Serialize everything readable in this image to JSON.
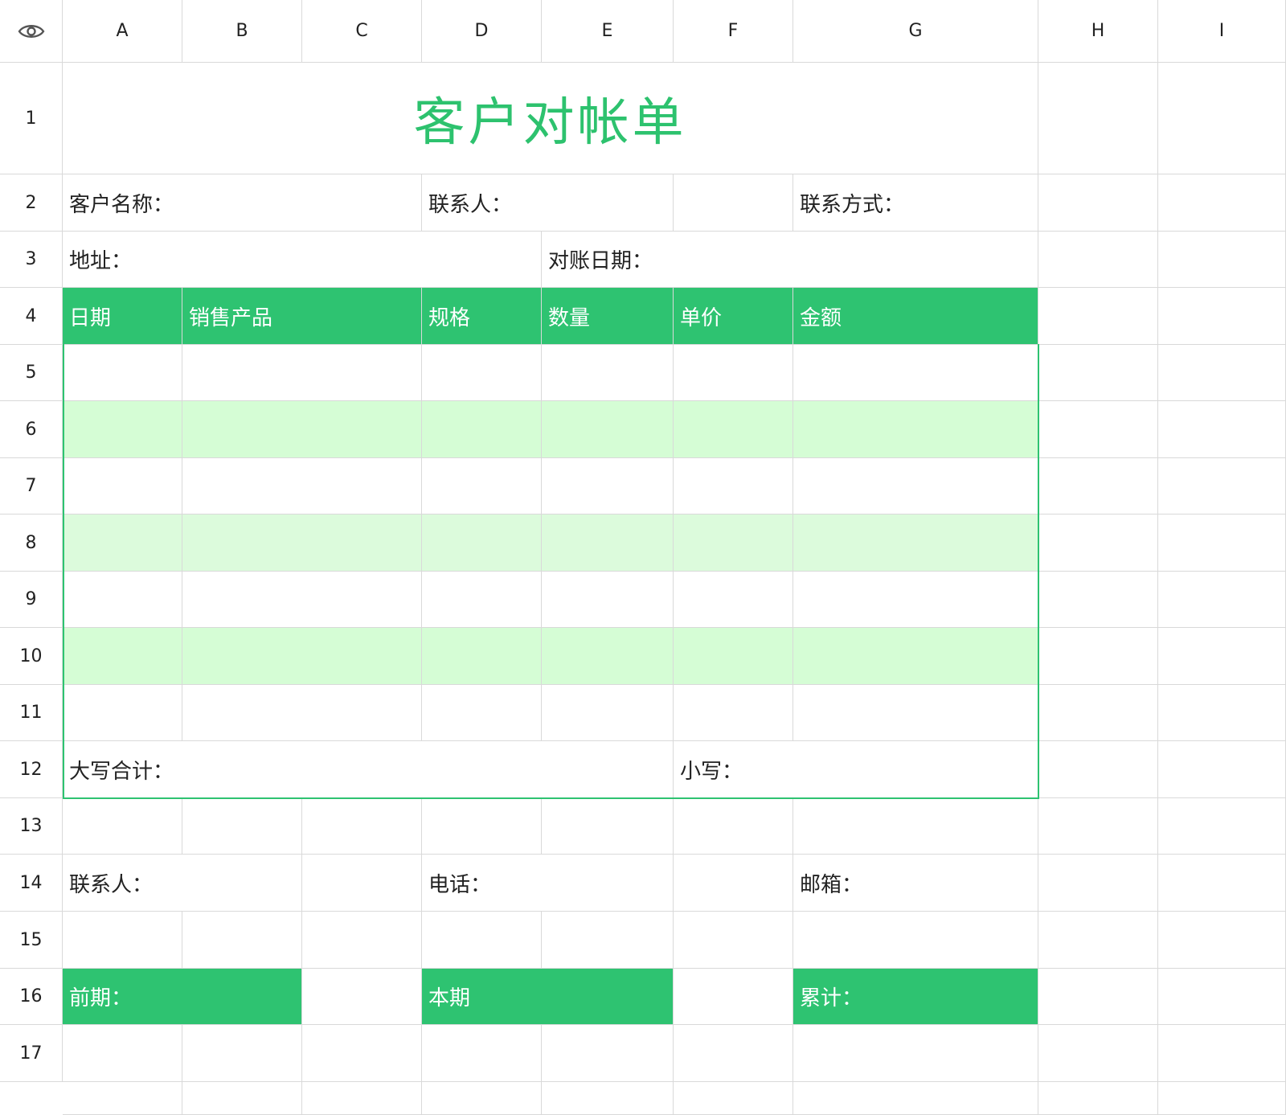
{
  "sheet": {
    "columns": [
      "A",
      "B",
      "C",
      "D",
      "E",
      "F",
      "G",
      "H",
      "I"
    ],
    "rows": [
      "1",
      "2",
      "3",
      "4",
      "5",
      "6",
      "7",
      "8",
      "9",
      "10",
      "11",
      "12",
      "13",
      "14",
      "15",
      "16",
      "17"
    ]
  },
  "doc": {
    "title": "客户对帐单",
    "customer_name_label": "客户名称：",
    "contact_label": "联系人：",
    "contact_method_label": "联系方式：",
    "address_label": "地址：",
    "date_label": "对账日期：",
    "table_headers": [
      "日期",
      "销售产品",
      "规格",
      "数量",
      "单价",
      "金额"
    ],
    "total_upper_label": "大写合计：",
    "total_lower_label": "小写：",
    "footer_contact_label": "联系人：",
    "phone_label": "电话：",
    "email_label": "邮箱：",
    "previous_label": "前期：",
    "current_label": "本期",
    "cumulative_label": "累计："
  },
  "colors": {
    "accent": "#2ec371",
    "title": "#2dc26e",
    "stripe": "#d5fdd5",
    "grid": "#d9d9d9"
  },
  "icons": {
    "visibility": "eye-icon"
  }
}
